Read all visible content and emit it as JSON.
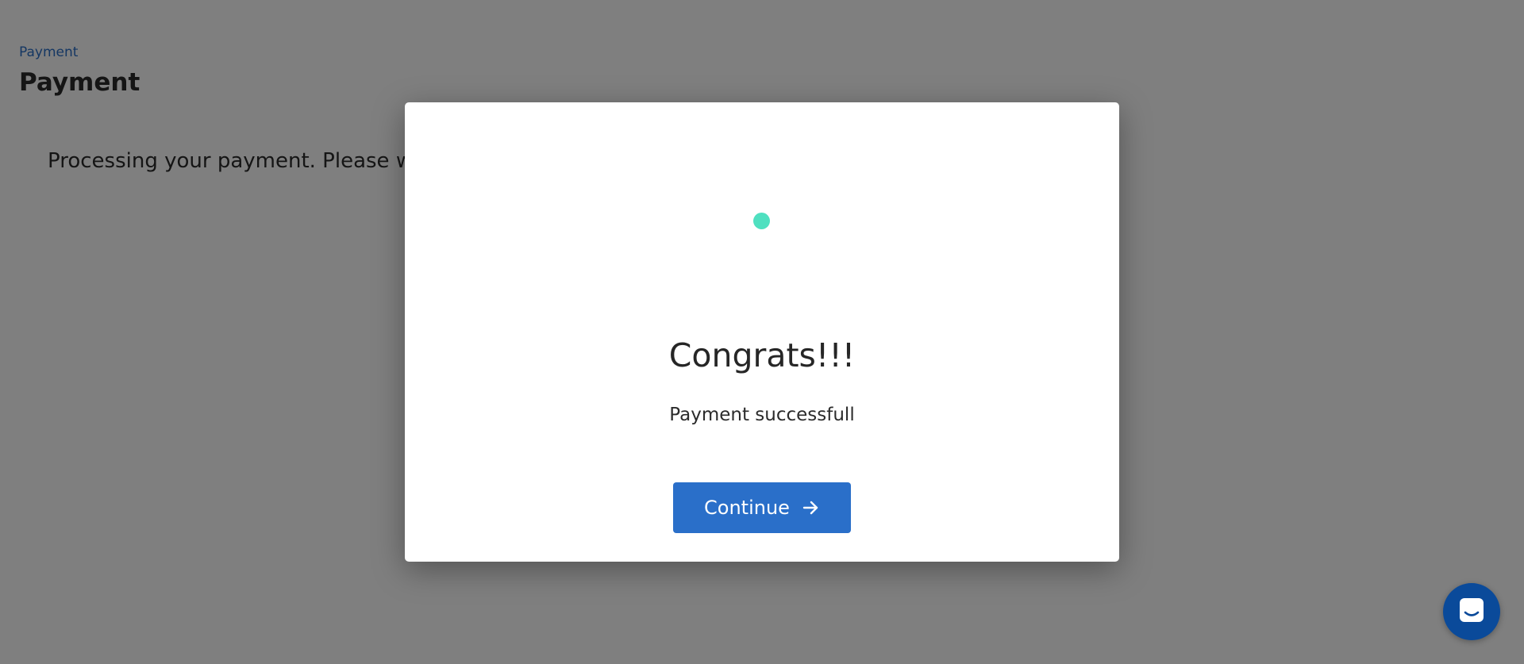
{
  "header": {
    "breadcrumb": "Payment",
    "title": "Payment"
  },
  "main": {
    "status_text": "Processing your payment. Please wait"
  },
  "modal": {
    "title": "Congrats!!!",
    "subtitle": "Payment successfull",
    "continue_label": "Continue",
    "continue_icon": "arrow-right-icon",
    "loader_color": "#4fe0c0"
  },
  "chat_widget": {
    "icon": "chat-icon"
  },
  "colors": {
    "primary": "#2a6fc9",
    "chat_bg": "#0a4a9a",
    "overlay": "rgba(0,0,0,0.5)"
  }
}
